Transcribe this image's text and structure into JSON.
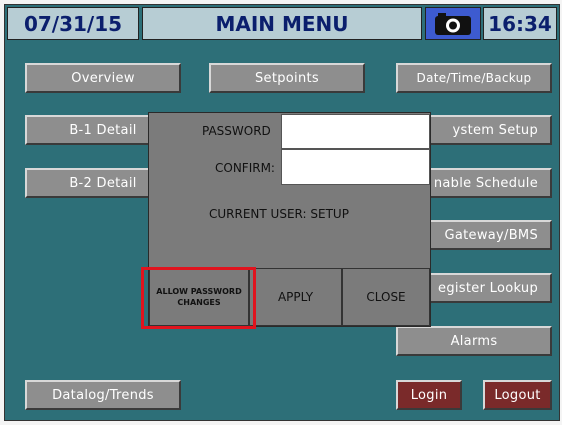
{
  "header": {
    "date": "07/31/15",
    "title": "MAIN MENU",
    "time": "16:34",
    "camera_icon": "camera-icon"
  },
  "left_buttons": {
    "overview": "Overview",
    "b1_detail": "B-1 Detail",
    "b2_detail": "B-2 Detail",
    "datalog": "Datalog/Trends"
  },
  "center_buttons": {
    "setpoints": "Setpoints"
  },
  "right_buttons": {
    "datetime": "Date/Time/Backup",
    "system_setup": "ystem Setup",
    "schedule": "nable Schedule",
    "gateway": "Gateway/BMS",
    "register": "egister Lookup",
    "alarms": "Alarms",
    "login": "Login",
    "logout": "Logout"
  },
  "dialog": {
    "password_label": "PASSWORD",
    "confirm_label": "CONFIRM:",
    "password_value": "",
    "confirm_value": "",
    "current_user_label": "CURRENT USER:",
    "current_user": "SETUP",
    "allow_line1": "ALLOW PASSWORD",
    "allow_line2": "CHANGES",
    "apply": "APPLY",
    "close": "CLOSE"
  },
  "colors": {
    "background": "#2d6f78",
    "button": "#8e8e8e",
    "login_button": "#7a2a2a",
    "highlight": "#e0141e"
  }
}
